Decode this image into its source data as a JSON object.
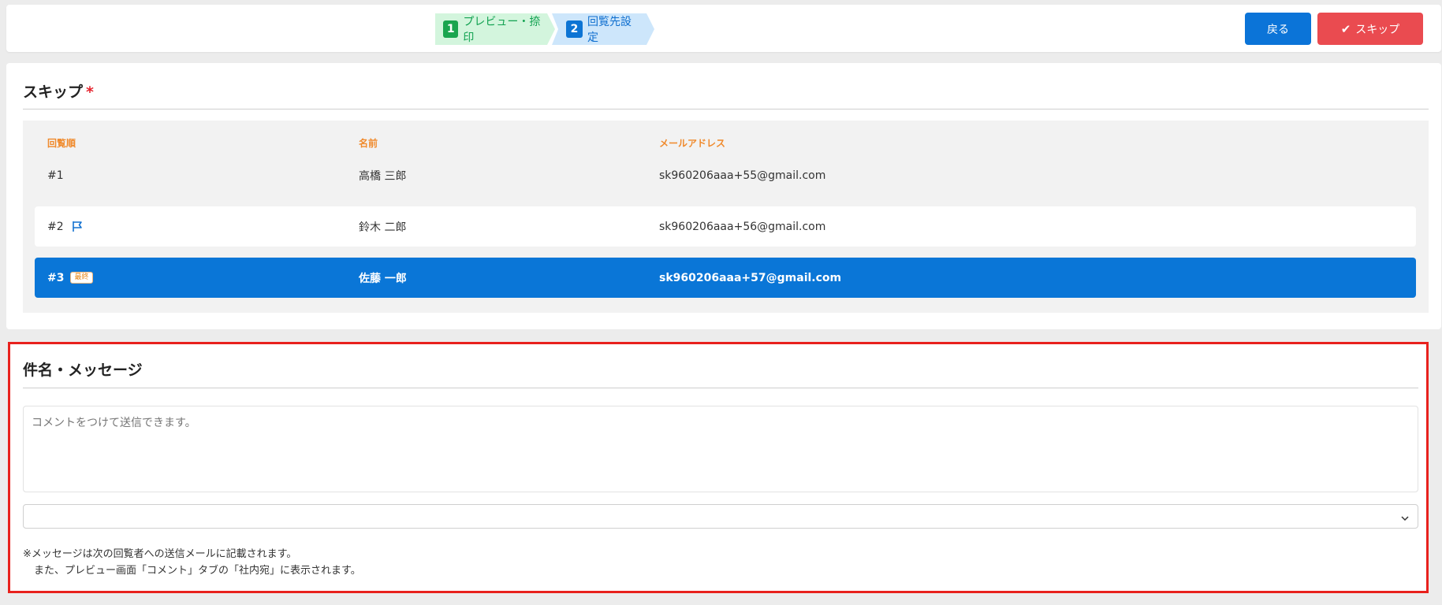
{
  "steps": [
    {
      "num": "1",
      "label": "プレビュー・捺印"
    },
    {
      "num": "2",
      "label": "回覧先設定"
    }
  ],
  "buttons": {
    "back": "戻る",
    "skip": "スキップ"
  },
  "skip_section": {
    "title": "スキップ",
    "required_mark": "*",
    "columns": [
      "回覧順",
      "名前",
      "メールアドレス"
    ],
    "rows": [
      {
        "order": "#1",
        "name": "高橋 三郎",
        "email": "sk960206aaa+55@gmail.com"
      },
      {
        "order": "#2",
        "name": "鈴木 二郎",
        "email": "sk960206aaa+56@gmail.com"
      },
      {
        "order": "#3",
        "badge": "最終",
        "name": "佐藤 一郎",
        "email": "sk960206aaa+57@gmail.com"
      }
    ]
  },
  "message_section": {
    "title": "件名・メッセージ",
    "placeholder": "コメントをつけて送信できます。",
    "select_value": "",
    "note_line1": "※メッセージは次の回覧者への送信メールに記載されます。",
    "note_line2": "また、プレビュー画面「コメント」タブの「社内宛」に表示されます。"
  },
  "colors": {
    "primary": "#0b74d8",
    "danger": "#ea4b50",
    "highlight_border": "#e8211d",
    "header_orange": "#f08a2c"
  },
  "icons": {
    "check": "check-icon",
    "flag": "flag-icon",
    "chevron": "chevron-down-icon"
  }
}
